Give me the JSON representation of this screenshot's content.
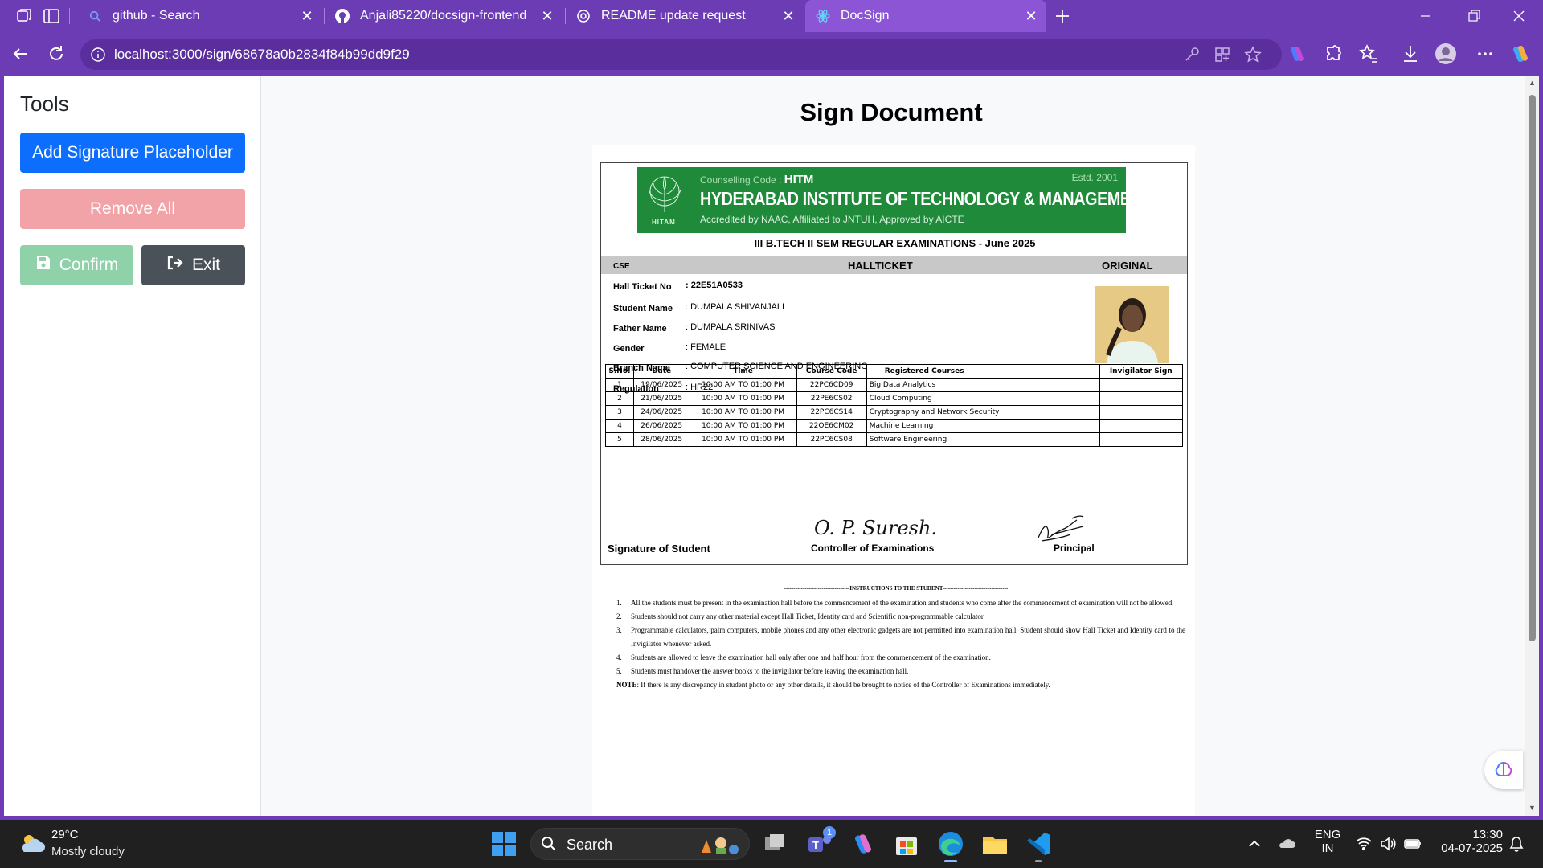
{
  "browser": {
    "tabs": [
      {
        "title": "github - Search",
        "active": false
      },
      {
        "title": "Anjali85220/docsign-frontend",
        "active": false
      },
      {
        "title": "README update request",
        "active": false
      },
      {
        "title": "DocSign",
        "active": true
      }
    ],
    "url": "localhost:3000/sign/68678a0b2834f84b99dd9f29"
  },
  "sidebar": {
    "title": "Tools",
    "add_placeholder": "Add Signature Placeholder",
    "remove_all": "Remove All",
    "confirm": "Confirm",
    "exit": "Exit"
  },
  "main": {
    "title": "Sign Document"
  },
  "document": {
    "counselling_label": "Counselling Code :",
    "counselling_code": "HITM",
    "estd": "Estd. 2001",
    "institute": "HYDERABAD INSTITUTE OF TECHNOLOGY & MANAGEMENT",
    "accreditation": "Accredited by NAAC, Affiliated to JNTUH, Approved by AICTE",
    "logo_text": "HITAM",
    "exam_title": "III B.TECH II SEM REGULAR EXAMINATIONS - June 2025",
    "branch_code": "CSE",
    "hall_ticket": "HALLTICKET",
    "copy_type": "ORIGINAL",
    "fields": {
      "hall_ticket_no": {
        "label": "Hall Ticket No",
        "value": ": 22E51A0533"
      },
      "student_name": {
        "label": "Student Name",
        "value": ": DUMPALA SHIVANJALI"
      },
      "father_name": {
        "label": "Father Name",
        "value": ": DUMPALA SRINIVAS"
      },
      "gender": {
        "label": "Gender",
        "value": ": FEMALE"
      },
      "branch_name": {
        "label": "Branch Name",
        "value": ": COMPUTER SCIENCE AND ENGINEERING"
      },
      "regulation": {
        "label": "Regulation",
        "value": ": HR22"
      }
    },
    "table_headers": {
      "sno": "S.No.",
      "date": "Date",
      "time": "Time",
      "course_code": "Course Code",
      "registered_courses": "Registered Courses",
      "invigilator_sign": "Invigilator Sign"
    },
    "rows": [
      {
        "sno": "1",
        "date": "19/06/2025",
        "time": "10:00 AM TO 01:00 PM",
        "code": "22PC6CD09",
        "course": "Big Data Analytics"
      },
      {
        "sno": "2",
        "date": "21/06/2025",
        "time": "10:00 AM TO 01:00 PM",
        "code": "22PE6CS02",
        "course": "Cloud Computing"
      },
      {
        "sno": "3",
        "date": "24/06/2025",
        "time": "10:00 AM TO 01:00 PM",
        "code": "22PC6CS14",
        "course": "Cryptography and Network Security"
      },
      {
        "sno": "4",
        "date": "26/06/2025",
        "time": "10:00 AM TO 01:00 PM",
        "code": "22OE6CM02",
        "course": "Machine Learning"
      },
      {
        "sno": "5",
        "date": "28/06/2025",
        "time": "10:00 AM TO 01:00 PM",
        "code": "22PC6CS08",
        "course": "Software Engineering"
      }
    ],
    "signature_student": "Signature of Student",
    "signature_controller": "Controller of Examinations",
    "signature_principal": "Principal",
    "controller_handwriting": "O. P. Suresh.",
    "instructions_title": "-----------------------------------INSTRUCTIONS TO THE STUDENT-----------------------------------",
    "instructions": [
      {
        "n": "1.",
        "text": "All the students must be present in the examination hall before the commencement of the examination and students who come after the commencement of examination will not be allowed."
      },
      {
        "n": "2.",
        "text": "Students should not carry any other material except Hall Ticket, Identity card and Scientific non-programmable calculator."
      },
      {
        "n": "3.",
        "text": "Programmable calculators, palm computers, mobile phones and any other electronic gadgets are not permitted into examination hall. Student should show Hall Ticket and Identity card to the Invigilator whenever asked."
      },
      {
        "n": "4.",
        "text": "Students are allowed to leave the examination hall only after one and half hour from the commencement of the examination."
      },
      {
        "n": "5.",
        "text": "Students must handover the answer books to the invigilator before leaving the examination hall."
      }
    ],
    "note_label": "NOTE",
    "note_text": ": If there is any discrepancy in student photo or any other details, it should be brought to notice of the Controller of Examinations immediately."
  },
  "taskbar": {
    "temperature": "29°C",
    "weather": "Mostly cloudy",
    "search": "Search",
    "lang": "ENG",
    "region": "IN",
    "time": "13:30",
    "date": "04-07-2025",
    "teams_badge": "1"
  },
  "colors": {
    "browser_frame": "#6c3cb5",
    "primary": "#0d6efd",
    "danger_disabled": "#f2a3a7",
    "success_disabled": "#8fd2a9",
    "dark": "#4a5159",
    "banner_green": "#1f8a3a"
  }
}
